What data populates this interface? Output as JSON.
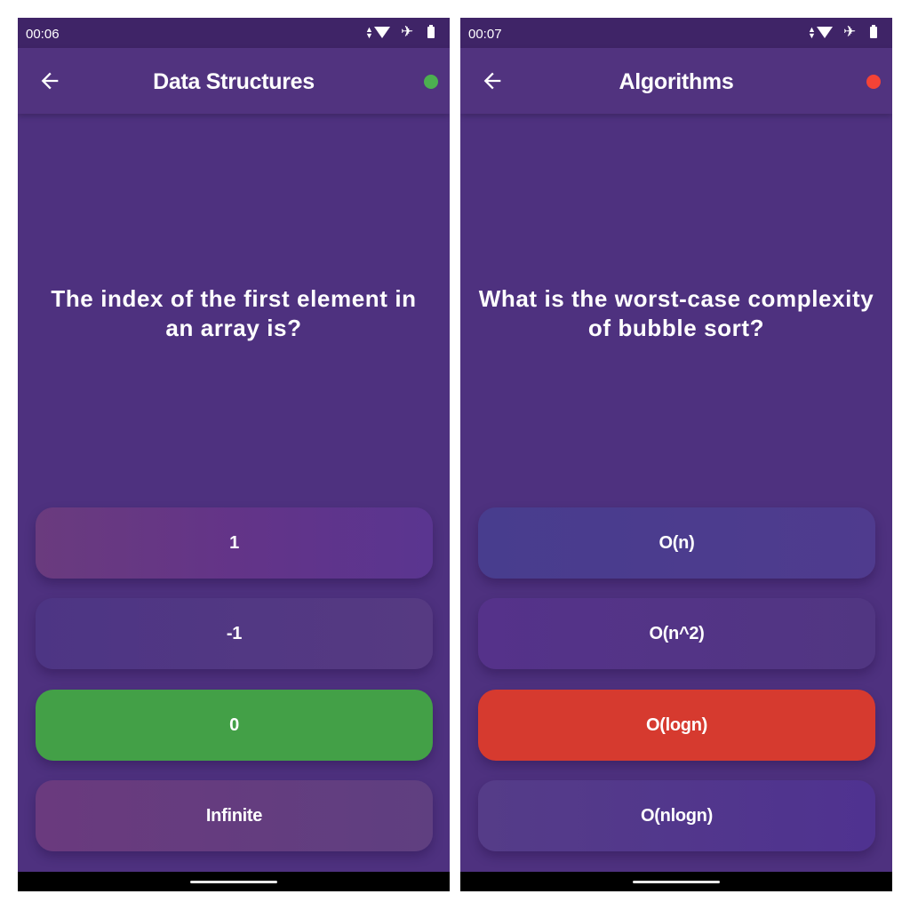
{
  "screens": [
    {
      "status_time": "00:06",
      "title": "Data Structures",
      "indicator_color": "#4caf50",
      "question": "The index of the first element in an array is?",
      "options": [
        {
          "label": "1",
          "state": "default"
        },
        {
          "label": "-1",
          "state": "default"
        },
        {
          "label": "0",
          "state": "correct",
          "color": "#43a047"
        },
        {
          "label": "Infinite",
          "state": "default"
        }
      ]
    },
    {
      "status_time": "00:07",
      "title": "Algorithms",
      "indicator_color": "#f44336",
      "question": "What is the worst-case complexity of bubble sort?",
      "options": [
        {
          "label": "O(n)",
          "state": "default"
        },
        {
          "label": "O(n^2)",
          "state": "default"
        },
        {
          "label": "O(logn)",
          "state": "wrong",
          "color": "#d63a2f"
        },
        {
          "label": "O(nlogn)",
          "state": "default"
        }
      ]
    }
  ],
  "icons": {
    "back": "arrow-back-icon",
    "data": "data-arrows-icon",
    "wifi": "wifi-icon",
    "airplane": "airplane-icon",
    "battery": "battery-icon"
  }
}
